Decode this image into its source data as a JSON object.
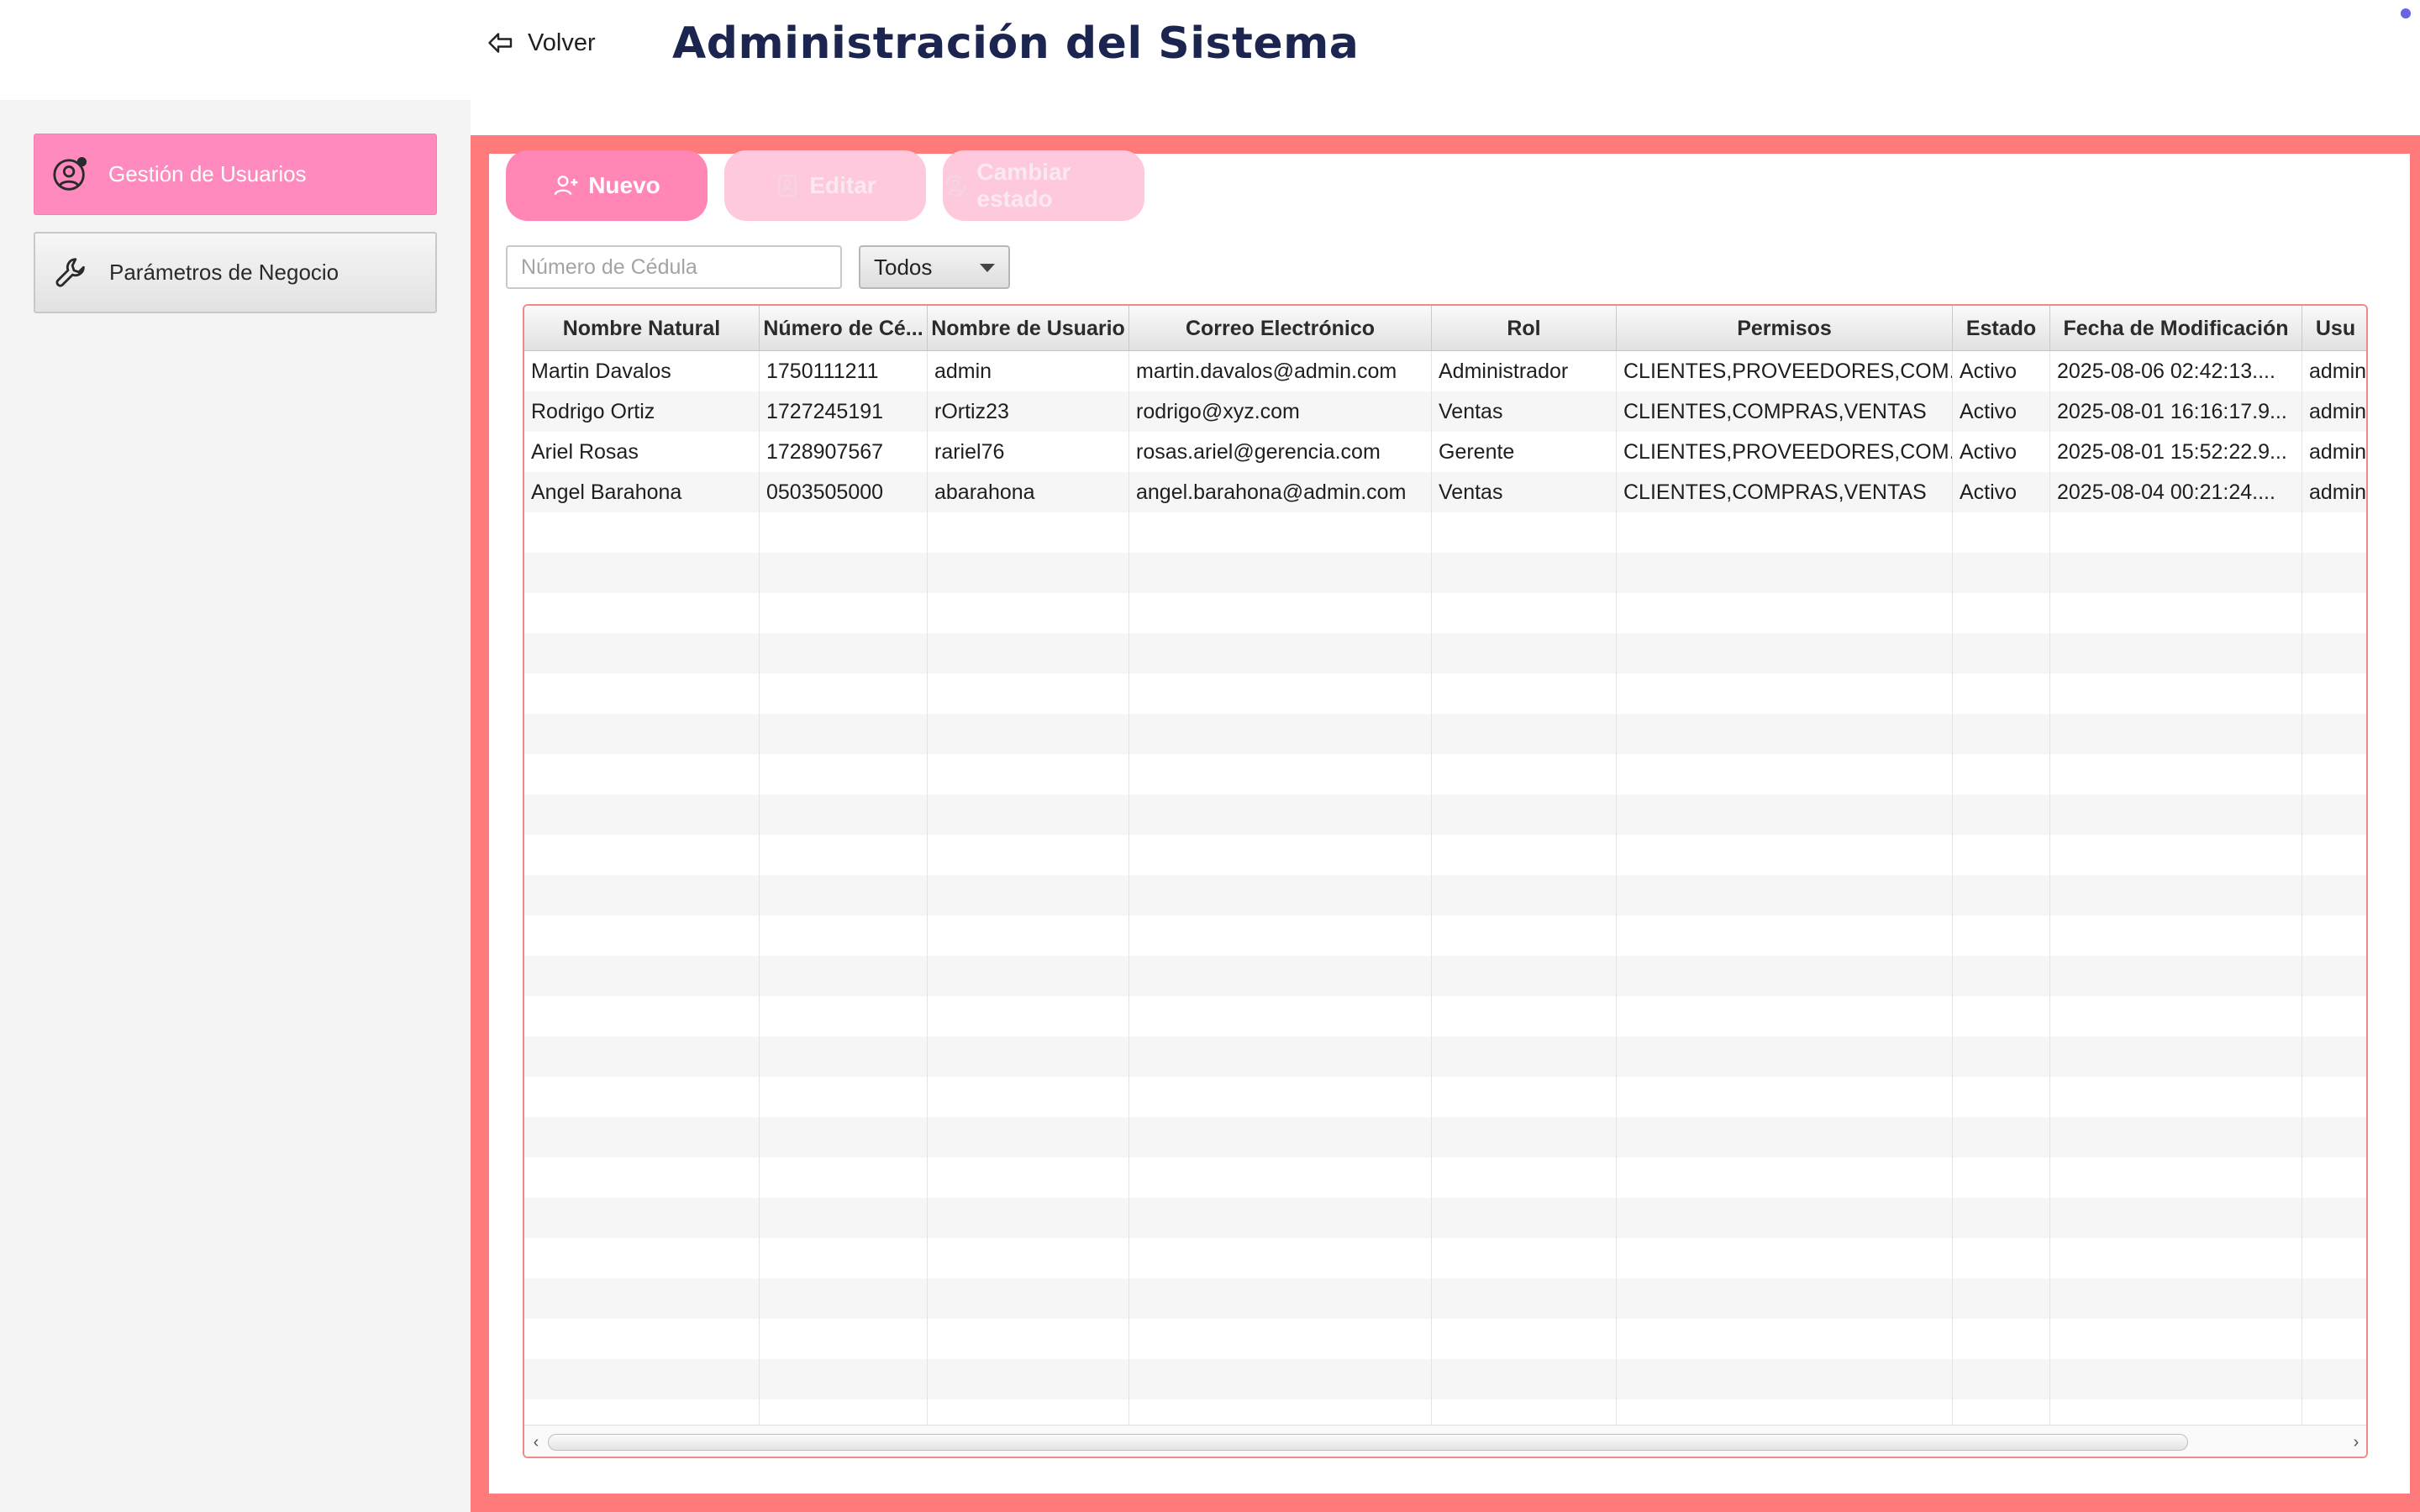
{
  "header": {
    "back_label": "Volver",
    "title": "Administración del Sistema"
  },
  "sidebar": {
    "items": [
      {
        "label": "Gestión de Usuarios",
        "icon": "user-gear-icon",
        "active": true
      },
      {
        "label": "Parámetros de Negocio",
        "icon": "wrench-icon",
        "active": false
      }
    ]
  },
  "toolbar": {
    "new_label": "Nuevo",
    "edit_label": "Editar",
    "state_label": "Cambiar estado"
  },
  "filters": {
    "search_placeholder": "Número de Cédula",
    "status_selected": "Todos"
  },
  "table": {
    "columns": [
      "Nombre Natural",
      "Número de Cé...",
      "Nombre de Usuario",
      "Correo Electrónico",
      "Rol",
      "Permisos",
      "Estado",
      "Fecha de Modificación",
      "Usu"
    ],
    "rows": [
      [
        "Martin Davalos",
        "1750111211",
        "admin",
        "martin.davalos@admin.com",
        "Administrador",
        "CLIENTES,PROVEEDORES,COM...",
        "Activo",
        "2025-08-06 02:42:13....",
        "admin"
      ],
      [
        "Rodrigo Ortiz",
        "1727245191",
        "rOrtiz23",
        "rodrigo@xyz.com",
        "Ventas",
        "CLIENTES,COMPRAS,VENTAS",
        "Activo",
        "2025-08-01 16:16:17.9...",
        "admin"
      ],
      [
        "Ariel Rosas",
        "1728907567",
        "rariel76",
        "rosas.ariel@gerencia.com",
        "Gerente",
        "CLIENTES,PROVEEDORES,COM...",
        "Activo",
        "2025-08-01 15:52:22.9...",
        "admin"
      ],
      [
        "Angel Barahona",
        "0503505000",
        "abarahona",
        "angel.barahona@admin.com",
        "Ventas",
        "CLIENTES,COMPRAS,VENTAS",
        "Activo",
        "2025-08-04 00:21:24....",
        "admin"
      ]
    ]
  },
  "colors": {
    "accent_pink": "#ff86b5",
    "frame_red": "#ff7a7a",
    "title_navy": "#1b2550"
  }
}
